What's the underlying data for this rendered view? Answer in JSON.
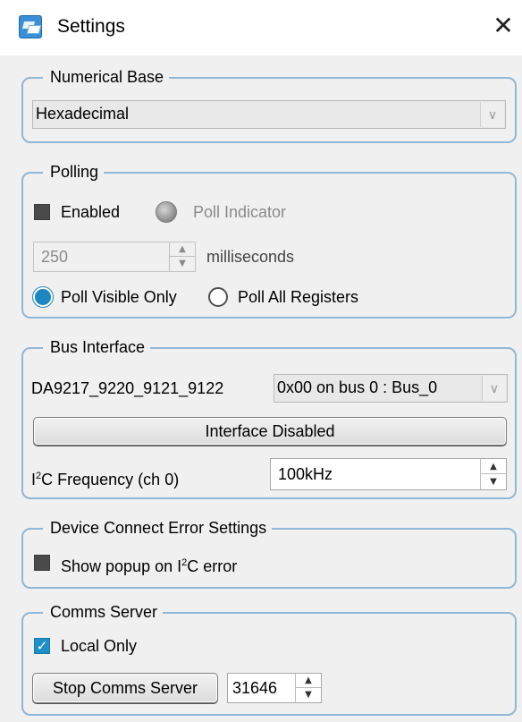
{
  "window": {
    "title": "Settings",
    "close_glyph": "✕",
    "icon": "app-icon"
  },
  "numerical_base": {
    "legend": "Numerical Base",
    "selected": "Hexadecimal",
    "arrow": "∨"
  },
  "polling": {
    "legend": "Polling",
    "enabled_label": "Enabled",
    "enabled_checked": false,
    "indicator_label": "Poll Indicator",
    "interval_value": "250",
    "interval_unit": "milliseconds",
    "radio_visible_label": "Poll Visible Only",
    "radio_all_label": "Poll All Registers",
    "selected_mode": "Poll Visible Only"
  },
  "bus_interface": {
    "legend": "Bus Interface",
    "device_name": "DA9217_9220_9121_9122",
    "bus_selected": "0x00 on bus 0 : Bus_0",
    "bus_arrow": "∨",
    "interface_button": "Interface Disabled",
    "freq_label_prefix": "I",
    "freq_label_sup": "2",
    "freq_label_suffix": "C Frequency (ch 0)",
    "freq_value": "100kHz"
  },
  "device_connect": {
    "legend": "Device Connect Error Settings",
    "popup_label_prefix": "Show popup on I",
    "popup_label_sup": "2",
    "popup_label_suffix": "C error",
    "popup_checked": false
  },
  "comms_server": {
    "legend": "Comms Server",
    "local_only_label": "Local Only",
    "local_only_checked": true,
    "check_glyph": "✓",
    "stop_button": "Stop Comms Server",
    "port_value": "31646"
  },
  "spin_glyphs": {
    "up": "▲",
    "down": "▼"
  },
  "colors": {
    "group_border": "#8fb7d8",
    "accent": "#1e87c1",
    "panel_bg": "#f0f0f0"
  }
}
